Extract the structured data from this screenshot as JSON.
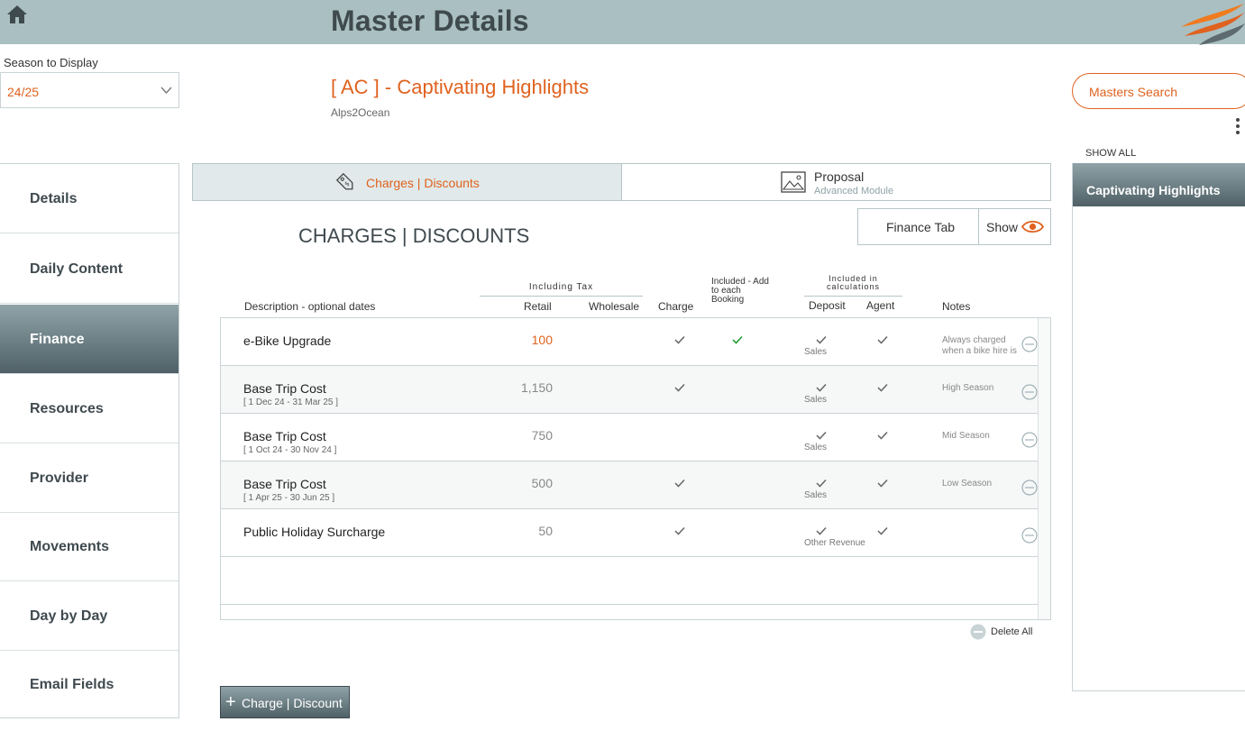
{
  "header": {
    "title": "Master Details"
  },
  "season": {
    "label": "Season to Display",
    "value": "24/25"
  },
  "master": {
    "name": "[ AC ] - Captivating Highlights",
    "subtitle": "Alps2Ocean"
  },
  "search": {
    "label": "Masters Search"
  },
  "nav": {
    "items": [
      {
        "label": "Details"
      },
      {
        "label": "Daily Content"
      },
      {
        "label": "Finance"
      },
      {
        "label": "Resources"
      },
      {
        "label": "Provider"
      },
      {
        "label": "Movements"
      },
      {
        "label": "Day by Day"
      },
      {
        "label": "Email Fields"
      }
    ],
    "active_index": 2
  },
  "tabs": {
    "charges": {
      "label": "Charges | Discounts"
    },
    "proposal": {
      "label": "Proposal",
      "sub": "Advanced Module"
    }
  },
  "section_title": "CHARGES | DISCOUNTS",
  "finance_tab": {
    "label": "Finance Tab",
    "show_label": "Show"
  },
  "columns": {
    "including_tax": "Including Tax",
    "description": "Description - optional dates",
    "retail": "Retail",
    "wholesale": "Wholesale",
    "charge": "Charge",
    "included_booking": "Included - Add to each Booking",
    "included_calc": "Included in calculations",
    "deposit": "Deposit",
    "agent": "Agent",
    "notes": "Notes"
  },
  "rows": [
    {
      "description": "e-Bike Upgrade",
      "dates": "",
      "retail": "100",
      "retail_highlight": true,
      "charge": true,
      "included_booking": true,
      "deposit": true,
      "deposit_tag": "Sales",
      "agent": true,
      "notes": "Always charged when a bike hire is upgraded to an"
    },
    {
      "description": "Base Trip Cost",
      "dates": "[ 1 Dec 24 - 31 Mar 25 ]",
      "retail": "1,150",
      "retail_highlight": false,
      "charge": true,
      "included_booking": false,
      "deposit": true,
      "deposit_tag": "Sales",
      "agent": true,
      "notes": "High Season"
    },
    {
      "description": "Base Trip Cost",
      "dates": "[ 1 Oct 24 - 30 Nov 24 ]",
      "retail": "750",
      "retail_highlight": false,
      "charge": false,
      "included_booking": false,
      "deposit": true,
      "deposit_tag": "Sales",
      "agent": true,
      "notes": "Mid Season"
    },
    {
      "description": "Base Trip Cost",
      "dates": "[ 1 Apr 25 - 30 Jun 25 ]",
      "retail": "500",
      "retail_highlight": false,
      "charge": true,
      "included_booking": false,
      "deposit": true,
      "deposit_tag": "Sales",
      "agent": true,
      "notes": "Low Season"
    },
    {
      "description": "Public Holiday Surcharge",
      "dates": "",
      "retail": "50",
      "retail_highlight": false,
      "charge": true,
      "included_booking": false,
      "deposit": true,
      "deposit_tag": "Other Revenue",
      "agent": true,
      "notes": ""
    }
  ],
  "delete_all": {
    "label": "Delete All"
  },
  "add_button": {
    "plus": "+",
    "label": "Charge | Discount"
  },
  "right_panel": {
    "show_all": "SHOW ALL",
    "selected": "Captivating Highlights"
  },
  "colors": {
    "accent": "#e0621f",
    "header_bg": "#a9bfc2",
    "nav_active": "#4f6166",
    "check_green": "#1a9a2a"
  }
}
